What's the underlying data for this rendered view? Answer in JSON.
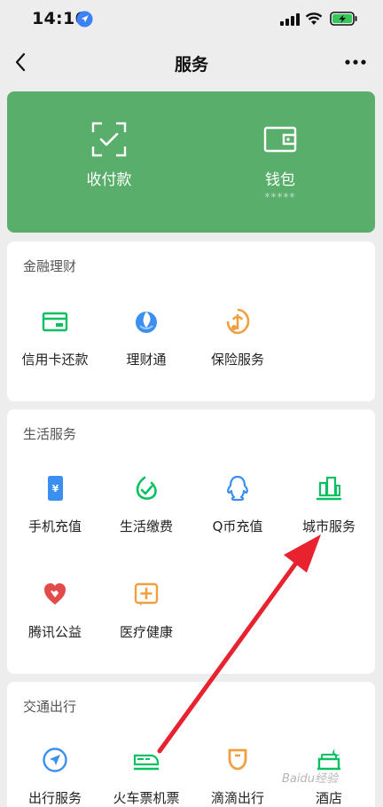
{
  "status_bar": {
    "time": "14:16"
  },
  "nav": {
    "title": "服务"
  },
  "pay_card": {
    "collect_label": "收付款",
    "wallet_label": "钱包",
    "wallet_balance_mask": "*****",
    "background": "#5aae6b"
  },
  "sections": {
    "finance": {
      "title": "金融理财",
      "items": [
        {
          "label": "信用卡还款",
          "icon": "credit-card-icon"
        },
        {
          "label": "理财通",
          "icon": "wealth-icon"
        },
        {
          "label": "保险服务",
          "icon": "insurance-icon"
        }
      ]
    },
    "life": {
      "title": "生活服务",
      "items": [
        {
          "label": "手机充值",
          "icon": "phone-topup-icon"
        },
        {
          "label": "生活缴费",
          "icon": "utility-bill-icon"
        },
        {
          "label": "Q币充值",
          "icon": "qq-coin-icon"
        },
        {
          "label": "城市服务",
          "icon": "city-service-icon"
        },
        {
          "label": "腾讯公益",
          "icon": "charity-icon"
        },
        {
          "label": "医疗健康",
          "icon": "medical-icon"
        }
      ]
    },
    "travel": {
      "title": "交通出行",
      "items": [
        {
          "label": "出行服务",
          "icon": "navigation-icon"
        },
        {
          "label": "火车票机票",
          "icon": "train-ticket-icon"
        },
        {
          "label": "滴滴出行",
          "icon": "didi-icon"
        },
        {
          "label": "酒店",
          "icon": "hotel-icon"
        }
      ]
    }
  },
  "watermark": "Baidu经验",
  "colors": {
    "green": "#07c160",
    "blue": "#3b8ff0",
    "orange": "#f0a040",
    "red": "#e34b4b",
    "arrow": "#e8232f"
  }
}
